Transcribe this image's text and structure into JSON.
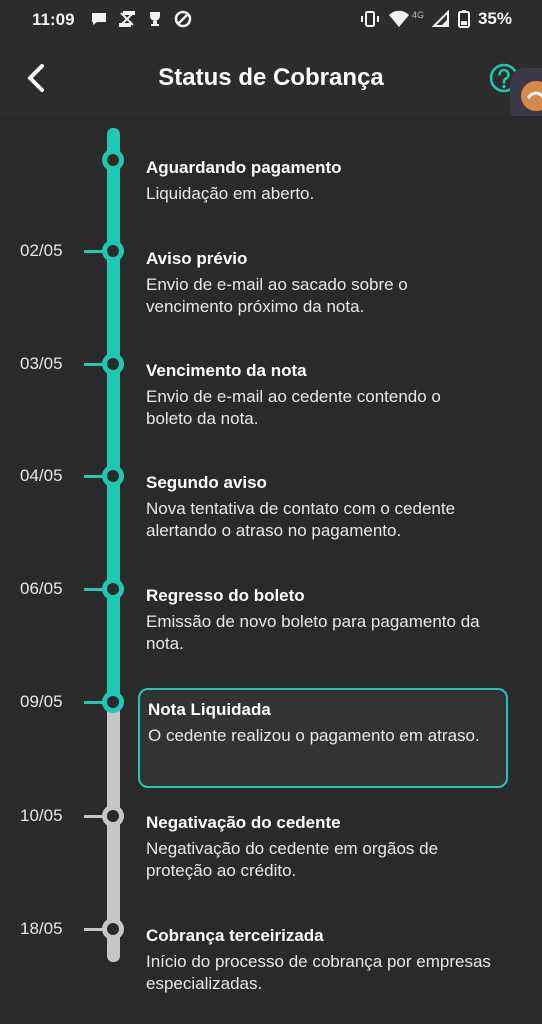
{
  "status_bar": {
    "time": "11:09",
    "network": "4G",
    "battery": "35%"
  },
  "header": {
    "title": "Status de Cobrança",
    "back_icon": "chevron-left-icon",
    "help_icon": "help-circle-icon"
  },
  "colors": {
    "accent": "#1ec8b4",
    "inactive": "#c6c6c6",
    "background": "#2a2a2a"
  },
  "timeline": [
    {
      "date": "",
      "title": "Aguardando pagamento",
      "desc": "Liquidação em aberto.",
      "done": true
    },
    {
      "date": "02/05",
      "title": "Aviso prévio",
      "desc": "Envio de e-mail ao sacado sobre o vencimento próximo da nota.",
      "done": true
    },
    {
      "date": "03/05",
      "title": "Vencimento da nota",
      "desc": "Envio de e-mail ao cedente contendo o boleto da nota.",
      "done": true
    },
    {
      "date": "04/05",
      "title": "Segundo aviso",
      "desc": "Nova tentativa de contato com o cedente alertando o atraso no pagamento.",
      "done": true
    },
    {
      "date": "06/05",
      "title": "Regresso do boleto",
      "desc": "Emissão de novo boleto para pagamento da nota.",
      "done": true
    },
    {
      "date": "09/05",
      "title": "Nota Liquidada",
      "desc": "O cedente realizou o pagamento em atraso.",
      "done": true,
      "current": true
    },
    {
      "date": "10/05",
      "title": "Negativação do cedente",
      "desc": "Negativação do cedente em orgãos de proteção ao crédito.",
      "done": false
    },
    {
      "date": "18/05",
      "title": "Cobrança terceirizada",
      "desc": "Início do processo de cobrança por empresas especializadas.",
      "done": false
    }
  ]
}
